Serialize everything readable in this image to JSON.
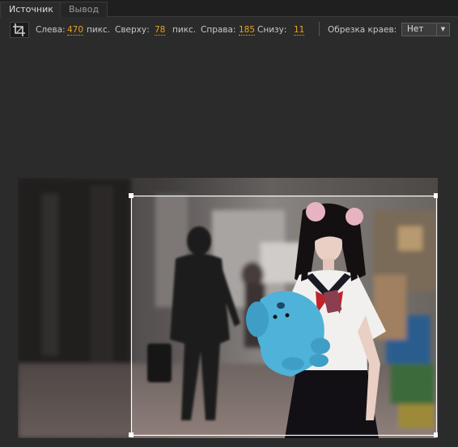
{
  "tabs": [
    {
      "label": "Источник",
      "active": true
    },
    {
      "label": "Вывод",
      "active": false
    }
  ],
  "toolbar": {
    "crop_icon": "crop-icon",
    "left_label": "Слева:",
    "left_value": "470",
    "left_unit": "пикс.",
    "top_label": "Сверху:",
    "top_value": "78",
    "top_unit": "пикс.",
    "right_label": "Справа:",
    "right_value": "185",
    "bottom_label": "Снизу:",
    "bottom_value": "11",
    "edge_crop_label": "Обрезка краев:",
    "edge_crop_value": "Нет"
  },
  "colors": {
    "accent_value": "#e8a320",
    "background": "#2b2b2b",
    "crop_frame": "#ffffff"
  }
}
